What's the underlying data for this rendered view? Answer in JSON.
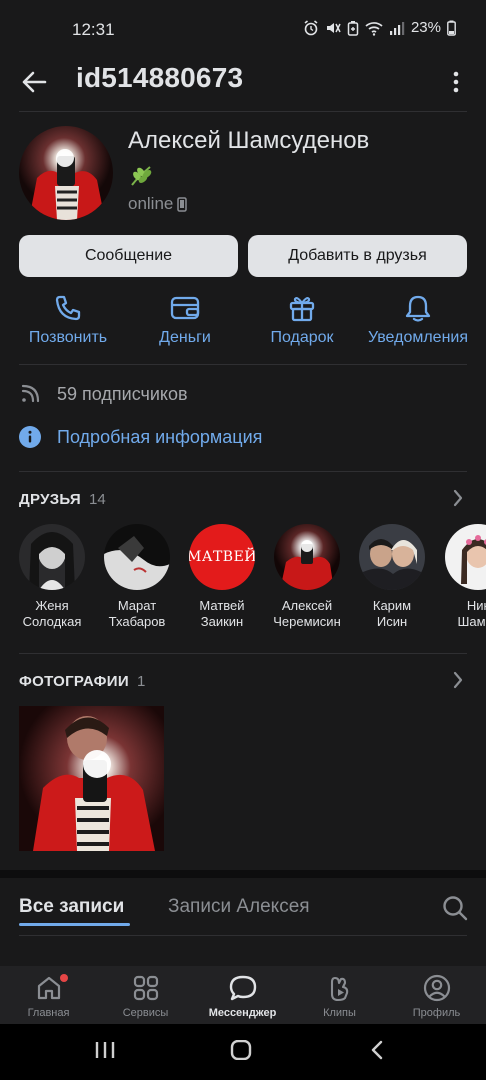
{
  "status_bar": {
    "time": "12:31",
    "battery": "23%"
  },
  "app_bar": {
    "title": "id514880673"
  },
  "profile": {
    "name": "Алексей Шамсуденов",
    "online": "online"
  },
  "buttons": {
    "message": "Сообщение",
    "add_friend": "Добавить в друзья"
  },
  "actions": [
    {
      "label": "Позвонить",
      "icon": "phone-icon"
    },
    {
      "label": "Деньги",
      "icon": "wallet-icon"
    },
    {
      "label": "Подарок",
      "icon": "gift-icon"
    },
    {
      "label": "Уведомления",
      "icon": "bell-icon"
    }
  ],
  "subscribers": "59 подписчиков",
  "details": "Подробная информация",
  "friends": {
    "title": "ДРУЗЬЯ",
    "count": "14",
    "items": [
      {
        "first": "Женя",
        "last": "Солодкая"
      },
      {
        "first": "Марат",
        "last": "Тхабаров"
      },
      {
        "first": "Матвей",
        "last": "Заикин",
        "avatar_text": "МАТВЕЙ"
      },
      {
        "first": "Алексей",
        "last": "Черемисин"
      },
      {
        "first": "Карим",
        "last": "Исин"
      },
      {
        "first": "Ник",
        "last": "Шамсу"
      }
    ]
  },
  "photos": {
    "title": "ФОТОГРАФИИ",
    "count": "1"
  },
  "wall_tabs": {
    "all": "Все записи",
    "author": "Записи Алексея"
  },
  "bottom_nav": [
    {
      "label": "Главная",
      "icon": "home-icon"
    },
    {
      "label": "Сервисы",
      "icon": "services-icon"
    },
    {
      "label": "Мессенджер",
      "icon": "messenger-icon",
      "active": true
    },
    {
      "label": "Клипы",
      "icon": "clips-icon"
    },
    {
      "label": "Профиль",
      "icon": "profile-icon"
    }
  ],
  "colors": {
    "background": "#19191a",
    "accent": "#71aaeb",
    "button": "#e1e3e6",
    "text_secondary": "#8b8e93",
    "badge": "#e64646"
  }
}
